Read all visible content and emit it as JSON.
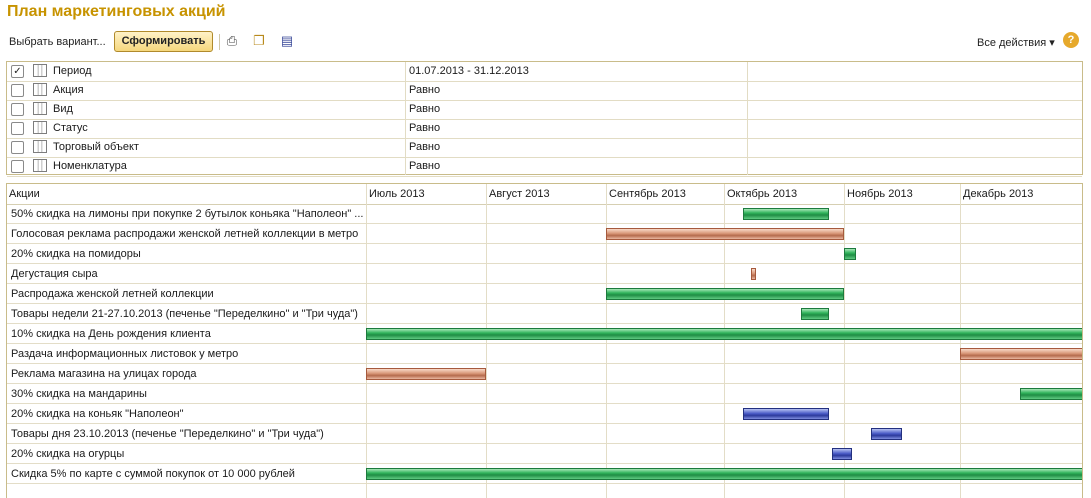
{
  "page": {
    "title": "План маркетинговых акций"
  },
  "toolbar": {
    "choose_variant": "Выбрать вариант...",
    "run": "Сформировать",
    "all_actions": "Все действия",
    "help": "?",
    "icons": [
      "printer-icon",
      "copy-icon",
      "save-icon"
    ]
  },
  "filters": [
    {
      "checked": true,
      "name": "Период",
      "value": "01.07.2013 - 31.12.2013"
    },
    {
      "checked": false,
      "name": "Акция",
      "value": "Равно"
    },
    {
      "checked": false,
      "name": "Вид",
      "value": "Равно"
    },
    {
      "checked": false,
      "name": "Статус",
      "value": "Равно"
    },
    {
      "checked": false,
      "name": "Торговый объект",
      "value": "Равно"
    },
    {
      "checked": false,
      "name": "Номенклатура",
      "value": "Равно"
    }
  ],
  "gantt": {
    "column_header": "Акции",
    "months": [
      "Июль 2013",
      "Август 2013",
      "Сентябрь 2013",
      "Октябрь 2013",
      "Ноябрь 2013",
      "Декабрь 2013"
    ],
    "colors": {
      "green": "#2fb35a",
      "orange": "#d89677",
      "blue": "#4a5bc7"
    },
    "rows": [
      {
        "name": "50% скидка на лимоны при покупке 2 бутылок коньяка \"Наполеон\" ...",
        "start": "2013-10-06",
        "end": "2013-10-27",
        "color": "green"
      },
      {
        "name": "Голосовая реклама распродажи женской летней коллекции в метро",
        "start": "2013-09-01",
        "end": "2013-10-31",
        "color": "orange"
      },
      {
        "name": "20% скидка на помидоры",
        "start": "2013-11-01",
        "end": "2013-11-03",
        "color": "green"
      },
      {
        "name": "Дегустация сыра",
        "start": "2013-10-08",
        "end": "2013-10-08",
        "color": "orange"
      },
      {
        "name": "Распродажа женской летней коллекции",
        "start": "2013-09-01",
        "end": "2013-10-31",
        "color": "green"
      },
      {
        "name": "Товары недели 21-27.10.2013 (печенье \"Переделкино\" и \"Три чуда\")",
        "start": "2013-10-21",
        "end": "2013-10-27",
        "color": "green"
      },
      {
        "name": "10% скидка на День рождения клиента",
        "start": "2013-07-01",
        "end": "2013-12-31",
        "color": "green"
      },
      {
        "name": "Раздача  информационных листовок у метро",
        "start": "2013-12-01",
        "end": "2013-12-31",
        "color": "orange"
      },
      {
        "name": "Реклама магазина на улицах города",
        "start": "2013-07-01",
        "end": "2013-07-31",
        "color": "orange"
      },
      {
        "name": "30% скидка на мандарины",
        "start": "2013-12-16",
        "end": "2013-12-31",
        "color": "green"
      },
      {
        "name": "20% скидка на коньяк \"Наполеон\"",
        "start": "2013-10-06",
        "end": "2013-10-27",
        "color": "blue"
      },
      {
        "name": "Товары дня 23.10.2013 (печенье \"Переделкино\" и \"Три чуда\")",
        "start": "2013-11-08",
        "end": "2013-11-15",
        "color": "blue"
      },
      {
        "name": "20% скидка на огурцы",
        "start": "2013-10-29",
        "end": "2013-11-02",
        "color": "blue"
      },
      {
        "name": "Скидка 5% по  карте с суммой покупок от 10 000 рублей",
        "start": "2013-07-01",
        "end": "2013-12-31",
        "color": "green"
      }
    ]
  }
}
